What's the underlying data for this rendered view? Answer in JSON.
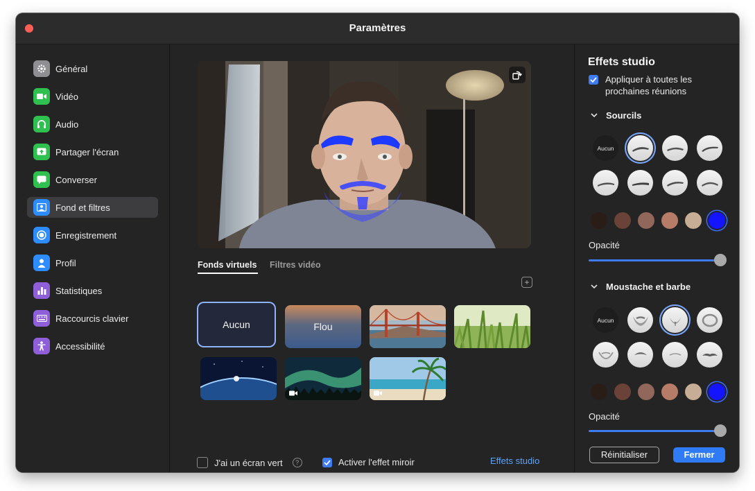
{
  "window": {
    "title": "Paramètres"
  },
  "sidebar": {
    "items": [
      {
        "label": "Général",
        "icon": "gear-icon",
        "color": "#8e8e93"
      },
      {
        "label": "Vidéo",
        "icon": "video-camera-icon",
        "color": "#30c04f"
      },
      {
        "label": "Audio",
        "icon": "headphones-icon",
        "color": "#30c04f"
      },
      {
        "label": "Partager l'écran",
        "icon": "share-screen-icon",
        "color": "#30c04f"
      },
      {
        "label": "Converser",
        "icon": "chat-bubble-icon",
        "color": "#30c04f"
      },
      {
        "label": "Fond et filtres",
        "icon": "background-person-icon",
        "color": "#2d8cff"
      },
      {
        "label": "Enregistrement",
        "icon": "record-icon",
        "color": "#2d8cff"
      },
      {
        "label": "Profil",
        "icon": "person-icon",
        "color": "#2d8cff"
      },
      {
        "label": "Statistiques",
        "icon": "bar-chart-icon",
        "color": "#8f5fd9"
      },
      {
        "label": "Raccourcis clavier",
        "icon": "keyboard-icon",
        "color": "#8f5fd9"
      },
      {
        "label": "Accessibilité",
        "icon": "accessibility-icon",
        "color": "#8f5fd9"
      }
    ],
    "active": "Fond et filtres"
  },
  "main": {
    "tabs": [
      {
        "label": "Fonds virtuels",
        "active": true
      },
      {
        "label": "Filtres vidéo",
        "active": false
      }
    ],
    "backgrounds": [
      {
        "label": "Aucun",
        "selected": true
      },
      {
        "label": "Flou",
        "selected": false
      },
      {
        "label": "",
        "scene": "golden-gate-bridge"
      },
      {
        "label": "",
        "scene": "grass"
      },
      {
        "label": "",
        "scene": "earth-from-space"
      },
      {
        "label": "",
        "scene": "aurora",
        "video": true
      },
      {
        "label": "",
        "scene": "beach-palm",
        "video": true
      }
    ],
    "green_screen_label": "J'ai un écran vert",
    "green_screen_checked": false,
    "mirror_label": "Activer l'effet miroir",
    "mirror_checked": true,
    "studio_link": "Effets studio"
  },
  "studio": {
    "title": "Effets studio",
    "apply_all_label": "Appliquer à toutes les prochaines réunions",
    "apply_all_checked": true,
    "eyebrows": {
      "title": "Sourcils",
      "none_label": "Aucun",
      "selected_index": 1,
      "colors": [
        "#2a1d18",
        "#6b4238",
        "#90675a",
        "#b67c68",
        "#c7ad95",
        "#1414ff"
      ],
      "selected_color": 5,
      "opacity_label": "Opacité",
      "opacity": 1.0
    },
    "beard": {
      "title": "Moustache et barbe",
      "none_label": "Aucun",
      "selected_index": 2,
      "colors": [
        "#2a1d18",
        "#6b4238",
        "#90675a",
        "#b67c68",
        "#c7ad95",
        "#1414ff"
      ],
      "selected_color": 5,
      "opacity_label": "Opacité",
      "opacity": 1.0
    },
    "reset_label": "Réinitialiser",
    "close_label": "Fermer",
    "accent": "#2f7bf5"
  }
}
